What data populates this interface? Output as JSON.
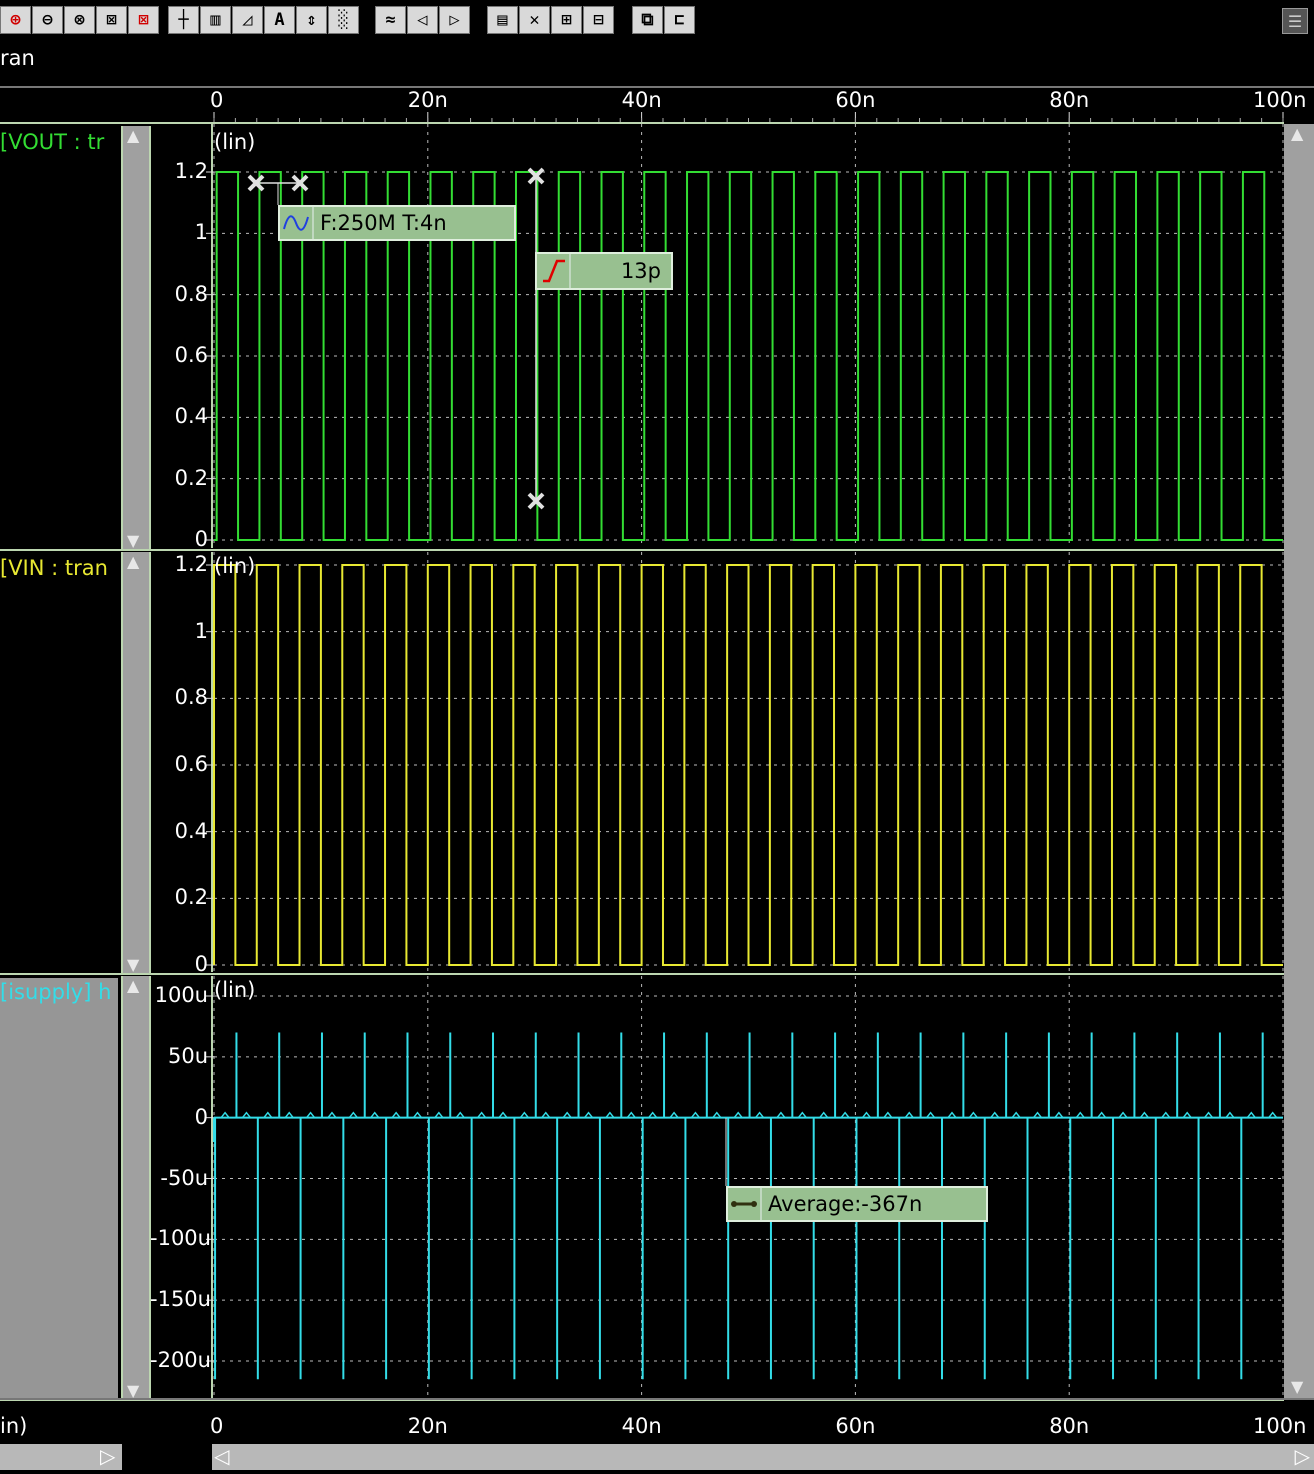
{
  "toolbar": {
    "groups": [
      {
        "items": [
          {
            "name": "zoom-in-icon",
            "glyph": "⊕",
            "red": true
          },
          {
            "name": "zoom-out-icon",
            "glyph": "⊖",
            "red": false
          },
          {
            "name": "zoom-fit-icon",
            "glyph": "⊗",
            "red": false
          },
          {
            "name": "zoom-x-icon",
            "glyph": "⊠",
            "red": false
          },
          {
            "name": "zoom-y-icon",
            "glyph": "⊠",
            "red": true
          }
        ]
      },
      {
        "items": [
          {
            "name": "cursor-icon",
            "glyph": "┼",
            "red": false
          },
          {
            "name": "grid-icon",
            "glyph": "▥",
            "red": false
          },
          {
            "name": "slope-icon",
            "glyph": "◿",
            "red": false
          },
          {
            "name": "label-icon",
            "glyph": "A",
            "red": false
          },
          {
            "name": "measure-icon",
            "glyph": "⇕",
            "red": false
          },
          {
            "name": "dots-icon",
            "glyph": "░",
            "red": false
          }
        ]
      },
      {
        "items": [
          {
            "name": "wave-icon",
            "glyph": "≈",
            "red": false
          },
          {
            "name": "prev-icon",
            "glyph": "◁",
            "red": false
          },
          {
            "name": "next-icon",
            "glyph": "▷",
            "red": false
          }
        ]
      },
      {
        "items": [
          {
            "name": "stack-icon",
            "glyph": "▤",
            "red": false
          },
          {
            "name": "delete-icon",
            "glyph": "✕",
            "red": false
          },
          {
            "name": "split-icon",
            "glyph": "⊞",
            "red": false
          },
          {
            "name": "merge-icon",
            "glyph": "⊟",
            "red": false
          }
        ]
      },
      {
        "items": [
          {
            "name": "panel-icon",
            "glyph": "⧉",
            "red": false
          },
          {
            "name": "layout-icon",
            "glyph": "⊏",
            "red": false
          }
        ]
      }
    ]
  },
  "analysis_label": "ran",
  "x_axis": {
    "ticks": [
      "0",
      "20n",
      "40n",
      "60n",
      "80n",
      "100n"
    ],
    "bottom_label": "in)"
  },
  "panels": [
    {
      "id": "vout",
      "name": "[VOUT : tr",
      "color": "#33dd33",
      "scale_label": "(lin)",
      "y_ticks": [
        "1.2",
        "1",
        "0.8",
        "0.6",
        "0.4",
        "0.2",
        "0"
      ],
      "y_values": [
        1.2,
        1.0,
        0.8,
        0.6,
        0.4,
        0.2,
        0.0
      ]
    },
    {
      "id": "vin",
      "name": "[VIN : tran",
      "color": "#e8e832",
      "scale_label": "(lin)",
      "y_ticks": [
        "1.2",
        "1",
        "0.8",
        "0.6",
        "0.4",
        "0.2",
        "0"
      ],
      "y_values": [
        1.2,
        1.0,
        0.8,
        0.6,
        0.4,
        0.2,
        0.0
      ]
    },
    {
      "id": "isupply",
      "name": "[isupply] h",
      "color": "#33dde8",
      "scale_label": "(lin)",
      "y_ticks": [
        "100u",
        "50u",
        "0",
        "-50u",
        "-100u",
        "-150u",
        "-200u"
      ],
      "y_values": [
        100,
        50,
        0,
        -50,
        -100,
        -150,
        -200
      ]
    }
  ],
  "markers": {
    "frequency": {
      "text": "F:250M T:4n"
    },
    "risetime": {
      "text": "13p"
    },
    "average": {
      "text": "Average:-367n"
    }
  },
  "chart_data": {
    "type": "line",
    "x_unit": "s",
    "xlim": [
      0,
      1e-07
    ],
    "series": [
      {
        "name": "VOUT",
        "period": 4e-09,
        "low": 0,
        "high": 1.2,
        "ylim": [
          0,
          1.2
        ]
      },
      {
        "name": "VIN",
        "period": 4e-09,
        "low": 0,
        "high": 1.2,
        "ylim": [
          0,
          1.2
        ]
      },
      {
        "name": "isupply",
        "period": 4e-09,
        "ylim": [
          -220,
          110
        ],
        "spike_max": 70,
        "spike_min": -215
      }
    ]
  }
}
